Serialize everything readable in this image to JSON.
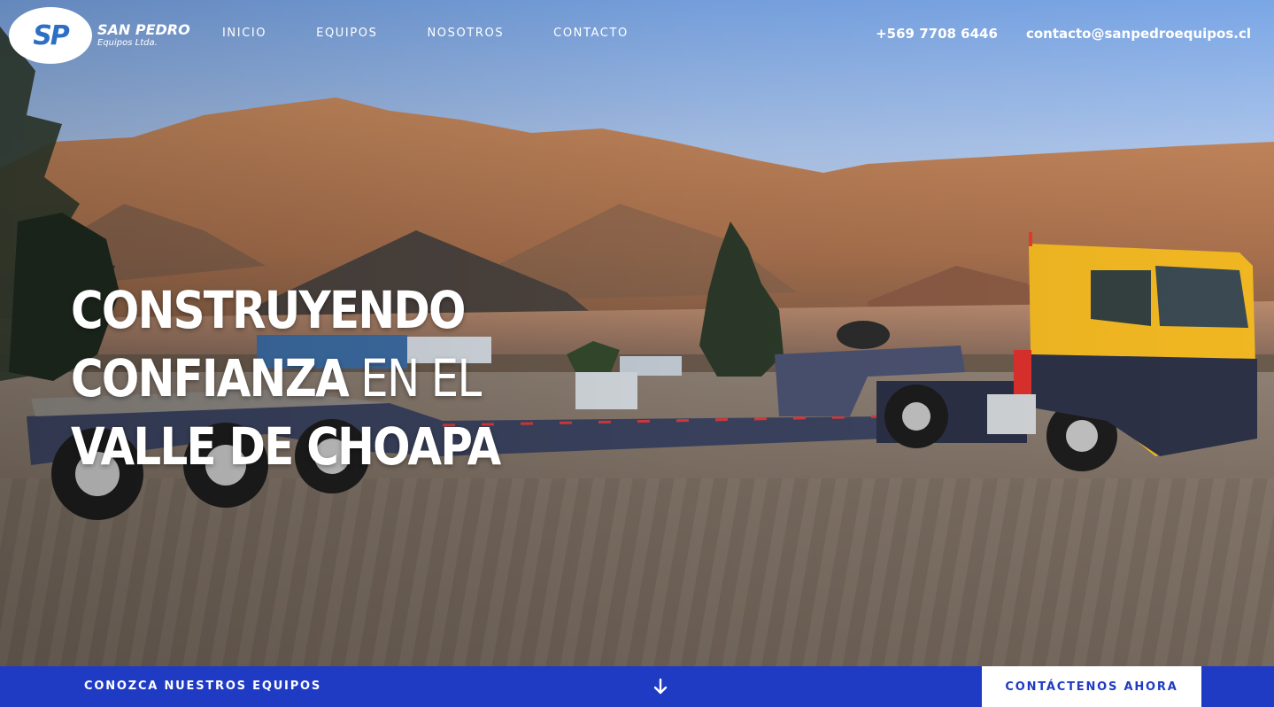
{
  "brand": {
    "mark": "SP",
    "name": "SAN PEDRO",
    "tagline": "Equipos Ltda."
  },
  "nav": {
    "items": [
      {
        "label": "INICIO"
      },
      {
        "label": "EQUIPOS"
      },
      {
        "label": "NOSOTROS"
      },
      {
        "label": "CONTACTO"
      }
    ]
  },
  "contact": {
    "phone": "+569 7708 6446",
    "email": "contacto@sanpedroequipos.cl"
  },
  "hero": {
    "line1": "CONSTRUYENDO",
    "line2_bold": "CONFIANZA",
    "line2_light": " EN EL",
    "line3": "VALLE DE CHOAPA"
  },
  "bottom_bar": {
    "explore_label": "CONOZCA NUESTROS EQUIPOS",
    "arrow_icon": "arrow-down-icon",
    "cta_label": "CONTÁCTENOS AHORA"
  },
  "colors": {
    "accent_blue": "#1f3bc4",
    "logo_blue": "#2d6fc4",
    "white": "#ffffff"
  }
}
